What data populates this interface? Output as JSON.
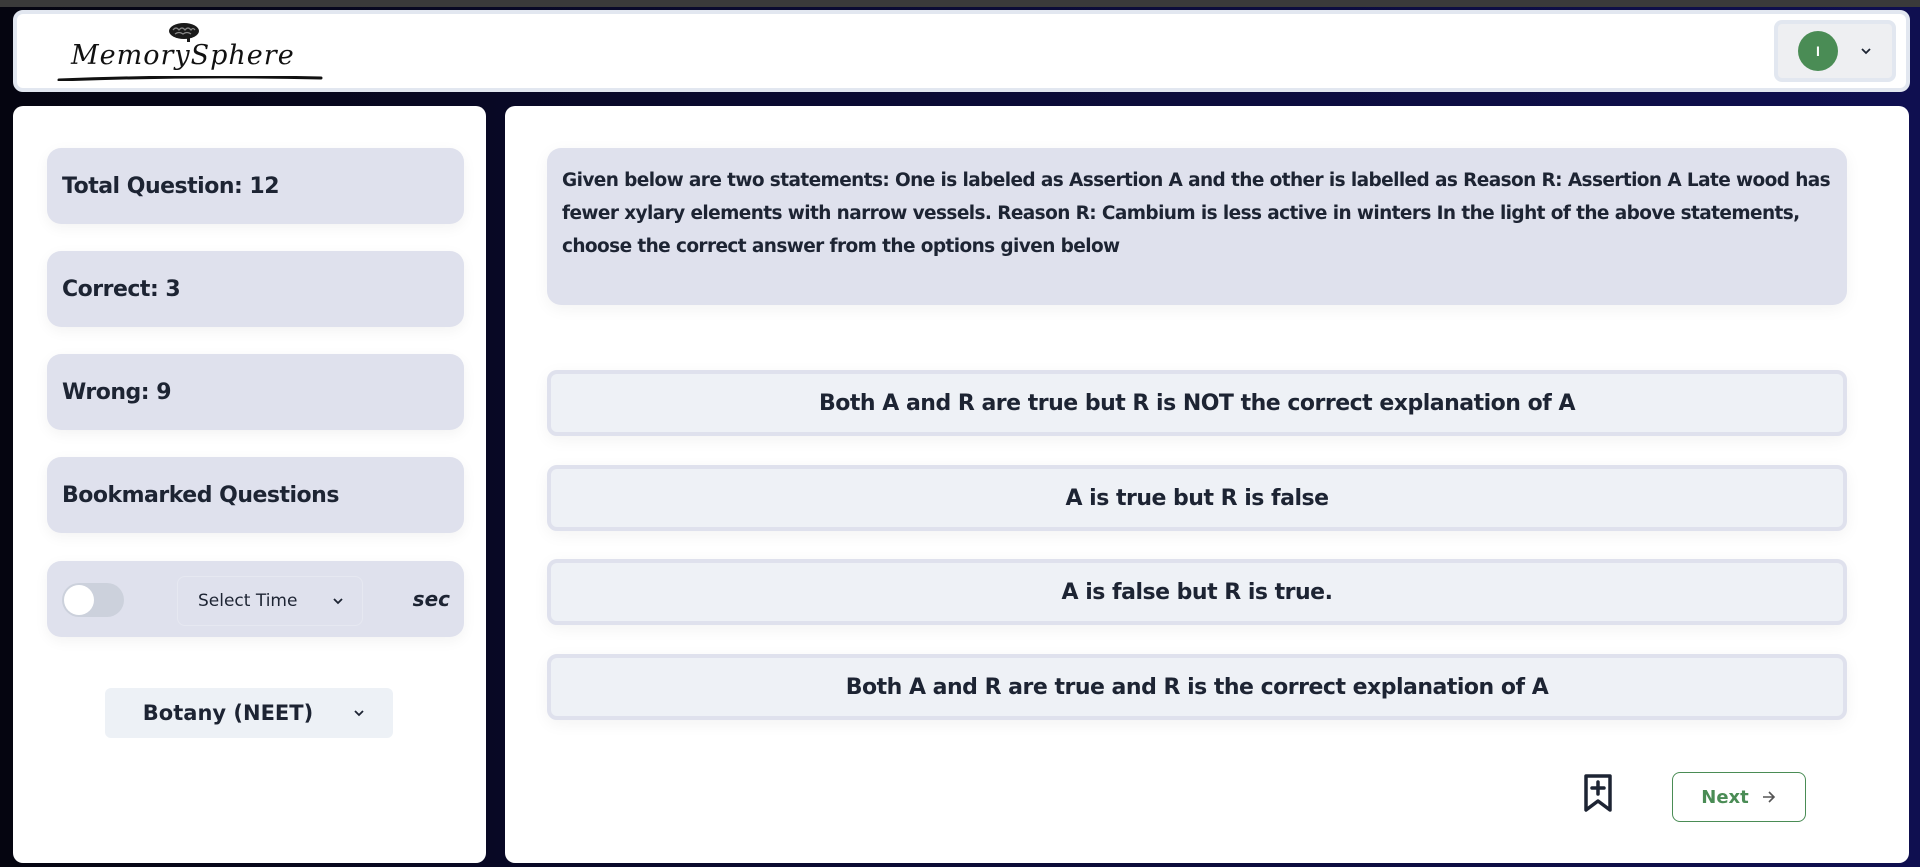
{
  "app": {
    "name": "MemorySphere",
    "logo_icon": "brain-icon"
  },
  "header": {
    "user_initial": "I",
    "user_menu_icon": "chevron-down-icon"
  },
  "sidebar": {
    "total_question": "Total Question: 12",
    "correct": "Correct: 3",
    "wrong": "Wrong: 9",
    "bookmarked": "Bookmarked Questions",
    "timer": {
      "enabled": false,
      "select_label": "Select Time",
      "unit": "sec"
    },
    "subject": {
      "selected": "Botany (NEET)"
    }
  },
  "question": {
    "text": "Given below are two statements: One is labeled as Assertion A and the other is labelled as Reason R:  Assertion A Late wood has fewer xylary elements with narrow vessels.  Reason R: Cambium is less active in winters In the light of the above statements, choose the correct answer from the options given below",
    "options": [
      "Both A and R are true but R is NOT the correct explanation of A",
      "A is true but R is false",
      "A is false but R is true.",
      "Both A and R are true and R is the correct explanation of A"
    ]
  },
  "actions": {
    "bookmark_icon": "bookmark-plus-icon",
    "next_label": "Next",
    "next_icon": "arrow-right-icon"
  },
  "colors": {
    "accent": "#4a8c55",
    "card_bg": "#dfe1ed",
    "option_bg": "#eef1f6",
    "text": "#1d2433"
  }
}
